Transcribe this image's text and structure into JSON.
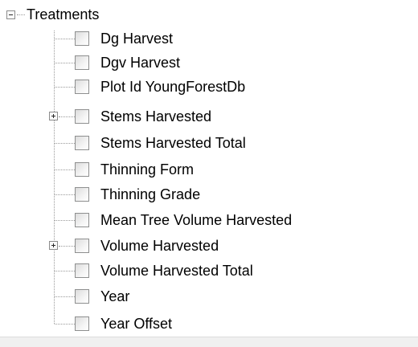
{
  "tree": {
    "root": {
      "label": "Treatments",
      "expanded": true
    },
    "items": [
      {
        "label": "Dg Harvest",
        "has_children": false,
        "checked": false
      },
      {
        "label": "Dgv Harvest",
        "has_children": false,
        "checked": false
      },
      {
        "label": "Plot Id YoungForestDb",
        "has_children": false,
        "checked": false
      },
      {
        "label": "Stems Harvested",
        "has_children": true,
        "checked": false
      },
      {
        "label": "Stems Harvested Total",
        "has_children": false,
        "checked": false
      },
      {
        "label": "Thinning Form",
        "has_children": false,
        "checked": false
      },
      {
        "label": "Thinning Grade",
        "has_children": false,
        "checked": false
      },
      {
        "label": "Mean Tree Volume Harvested",
        "has_children": false,
        "checked": false
      },
      {
        "label": "Volume Harvested",
        "has_children": true,
        "checked": false
      },
      {
        "label": "Volume Harvested Total",
        "has_children": false,
        "checked": false
      },
      {
        "label": "Year",
        "has_children": false,
        "checked": false
      },
      {
        "label": "Year Offset",
        "has_children": false,
        "checked": false
      }
    ]
  },
  "colors": {
    "background": "#ffffff",
    "text": "#000000",
    "tree_lines": "#9a9a9a",
    "checkbox_border": "#8e8f8f",
    "bottom_bar": "#f0f0f0"
  }
}
